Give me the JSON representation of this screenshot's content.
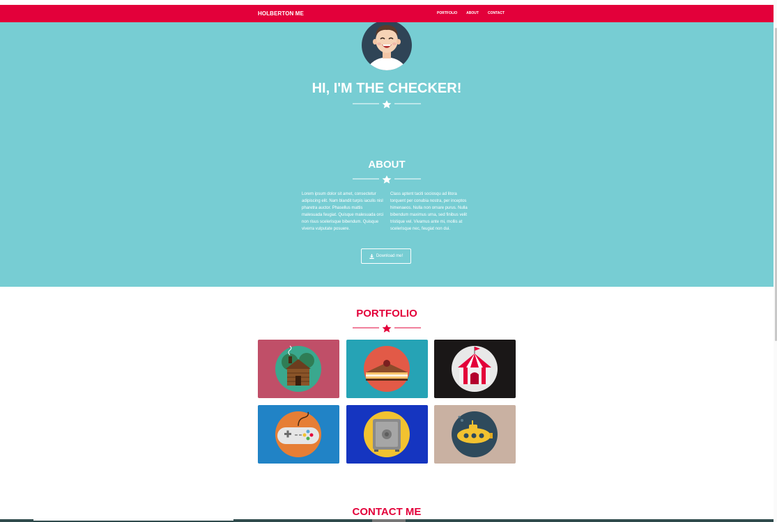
{
  "navbar": {
    "brand": "HOLBERTON ME",
    "links": [
      "PORTFOLIO",
      "ABOUT",
      "CONTACT"
    ],
    "color": "#e3003a"
  },
  "hero": {
    "title": "HI, I'M THE CHECKER!",
    "background": "#77cdd3",
    "avatar_icon": "avatar-icon"
  },
  "about": {
    "title": "ABOUT",
    "paragraphs": [
      "Lorem ipsum dolor sit amet, consectetur adipiscing elit. Nam blandit turpis iaculis nisl pharetra auctor. Phasellus mattis malesuada feugiat. Quisque malesuada orci non risus scelerisque bibendum. Quisque viverra vulputate posuere.",
      "Class aptent taciti sociosqu ad litora torquent per conubia nostra, per inceptos himenaeos. Nulla non ornare purus. Nulla bibendum maximus urna, sed finibus velit tristique vel. Vivamus ante mi, mollis at scelerisque nec, feugiat non dui."
    ],
    "download_label": "Download me!",
    "download_icon": "download-icon"
  },
  "portfolio": {
    "title": "PORTFOLIO",
    "items": [
      {
        "name": "cabin",
        "bg": "#c04f68"
      },
      {
        "name": "cake",
        "bg": "#26a3b5"
      },
      {
        "name": "circus",
        "bg": "#1a1717"
      },
      {
        "name": "game-controller",
        "bg": "#2183c6"
      },
      {
        "name": "safe",
        "bg": "#1535c0"
      },
      {
        "name": "submarine",
        "bg": "#c9b1a2"
      }
    ]
  },
  "contact": {
    "title": "CONTACT ME"
  }
}
